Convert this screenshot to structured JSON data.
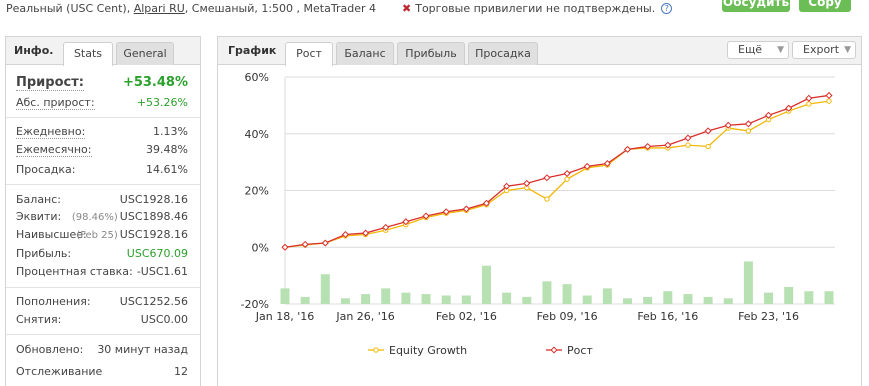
{
  "top": {
    "account_prefix": "Реальный (USC Cent),",
    "broker": "Alpari RU",
    "account_suffix": ", Смешаный, 1:500 , MetaTrader 4",
    "privileges_text": "Торговые привилегии не подтверждены.",
    "privileges_icon": "close-icon",
    "help_icon": "question-icon",
    "discuss_label": "Обсудить",
    "copy_label": "Copy",
    "button_color": "#6bbd55"
  },
  "left": {
    "tab_title": "Инфо.",
    "tabs": [
      "Stats",
      "General"
    ],
    "active_tab": "Stats",
    "gain": {
      "label": "Прирост:",
      "value": "+53.48%"
    },
    "abs_gain": {
      "label": "Абс. прирост:",
      "value": "+53.26%"
    },
    "daily": {
      "label": "Ежедневно:",
      "value": "1.13%"
    },
    "monthly": {
      "label": "Ежемесячно:",
      "value": "39.48%"
    },
    "drawdown": {
      "label": "Просадка:",
      "value": "14.61%"
    },
    "balance": {
      "label": "Баланс:",
      "value": "USC1928.16"
    },
    "equity": {
      "label": "Эквити:",
      "note": "(98.46%)",
      "value": "USC1898.46"
    },
    "highest": {
      "label": "Наивысшее:",
      "note": "(Feb 25)",
      "value": "USC1928.16"
    },
    "profit": {
      "label": "Прибыль:",
      "value": "USC670.09"
    },
    "interest": {
      "label": "Процентная ставка:",
      "value": "-USC1.61"
    },
    "deposits": {
      "label": "Пополнения:",
      "value": "USC1252.56"
    },
    "withdrawals": {
      "label": "Снятия:",
      "value": "USC0.00"
    },
    "updated": {
      "label": "Обновлено:",
      "value": "30 минут назад"
    },
    "tracking": {
      "label": "Отслеживание",
      "value": "12"
    },
    "positive_color": "#2ca02c"
  },
  "right": {
    "tab_title": "График",
    "tabs": [
      "Рост",
      "Баланс",
      "Прибыль",
      "Просадка"
    ],
    "active_tab": "Рост",
    "more_label": "Ещё",
    "export_label": "Export"
  },
  "chart_data": {
    "type": "line",
    "y_axis": {
      "min": -20,
      "max": 60,
      "ticks": [
        "60%",
        "40%",
        "20%",
        "0%",
        "-20%"
      ],
      "unit": "%"
    },
    "x_ticks": [
      "Jan 18, '16",
      "Jan 26, '16",
      "Feb 02, '16",
      "Feb 09, '16",
      "Feb 16, '16",
      "Feb 23, '16"
    ],
    "x_tick_index": [
      0,
      4,
      9,
      14,
      19,
      24
    ],
    "points": 28,
    "series": [
      {
        "name": "Equity Growth",
        "color": "#f2b705",
        "marker": "circle",
        "values": [
          0,
          0.8,
          1.5,
          4,
          4.5,
          6,
          8,
          10.5,
          12,
          13,
          15,
          20,
          21,
          17,
          24,
          28,
          29,
          34.5,
          35,
          35,
          36,
          35.5,
          42,
          41,
          45,
          48,
          50.5,
          51.5
        ]
      },
      {
        "name": "Рост",
        "color": "#d9302c",
        "marker": "diamond",
        "values": [
          0,
          1,
          1.5,
          4.5,
          5,
          7,
          9,
          11,
          12.5,
          13.5,
          15.5,
          21.5,
          22.5,
          24.5,
          26,
          28.5,
          29.5,
          34.5,
          35.5,
          36,
          38.5,
          41,
          43,
          43.5,
          46.5,
          49,
          52.5,
          53.5
        ]
      }
    ],
    "bars": {
      "color": "#b8e1b3",
      "values": [
        -14.5,
        -17.5,
        -9.5,
        -18,
        -16.5,
        -14.5,
        -16,
        -16.5,
        -17,
        -17,
        -6.5,
        -16,
        -17.5,
        -12,
        -13,
        -17,
        -14.5,
        -18,
        -17.5,
        -15.5,
        -16.5,
        -17.5,
        -18,
        -5,
        -16,
        -14,
        -15.5,
        -15.5
      ]
    },
    "legend": "bottom",
    "grid": "horizontal"
  }
}
